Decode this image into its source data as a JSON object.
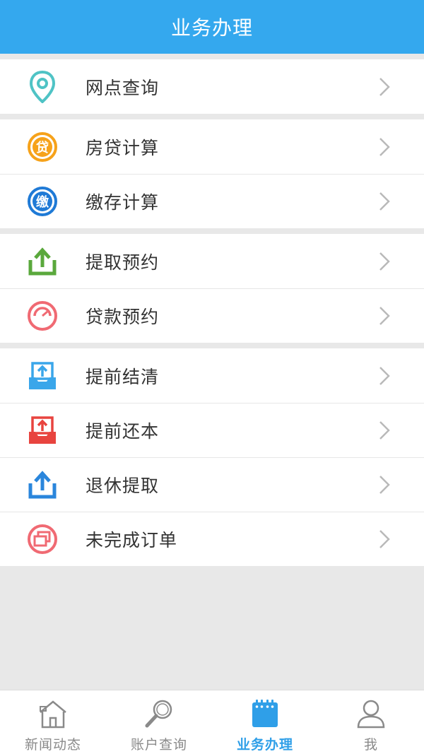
{
  "header": {
    "title": "业务办理"
  },
  "groups": [
    {
      "items": [
        {
          "label": "网点查询",
          "icon": "location-pin-icon"
        }
      ]
    },
    {
      "items": [
        {
          "label": "房贷计算",
          "icon": "loan-badge-icon",
          "badge": "贷"
        },
        {
          "label": "缴存计算",
          "icon": "deposit-badge-icon",
          "badge": "缴"
        }
      ]
    },
    {
      "items": [
        {
          "label": "提取预约",
          "icon": "upload-tray-icon"
        },
        {
          "label": "贷款预约",
          "icon": "gauge-icon"
        }
      ]
    },
    {
      "items": [
        {
          "label": "提前结清",
          "icon": "inbox-upload-icon"
        },
        {
          "label": "提前还本",
          "icon": "inbox-upload-icon"
        },
        {
          "label": "退休提取",
          "icon": "upload-tray-icon"
        },
        {
          "label": "未完成订单",
          "icon": "windows-stack-icon"
        }
      ]
    }
  ],
  "tabbar": {
    "tabs": [
      {
        "label": "新闻动态",
        "icon": "home-icon"
      },
      {
        "label": "账户查询",
        "icon": "magnifier-icon"
      },
      {
        "label": "业务办理",
        "icon": "calendar-icon",
        "active": true
      },
      {
        "label": "我",
        "icon": "user-icon"
      }
    ]
  },
  "colors": {
    "header_bg": "#34a8ee",
    "active_tab": "#2f9fe8",
    "pin": "#4fc3c5",
    "loan_orange": "#f6a21a",
    "deposit_blue": "#1f7ad6",
    "green": "#5aa83c",
    "pink": "#f06a73",
    "sky": "#3aa6ea",
    "red": "#e8443f",
    "blue": "#2a86dc"
  }
}
